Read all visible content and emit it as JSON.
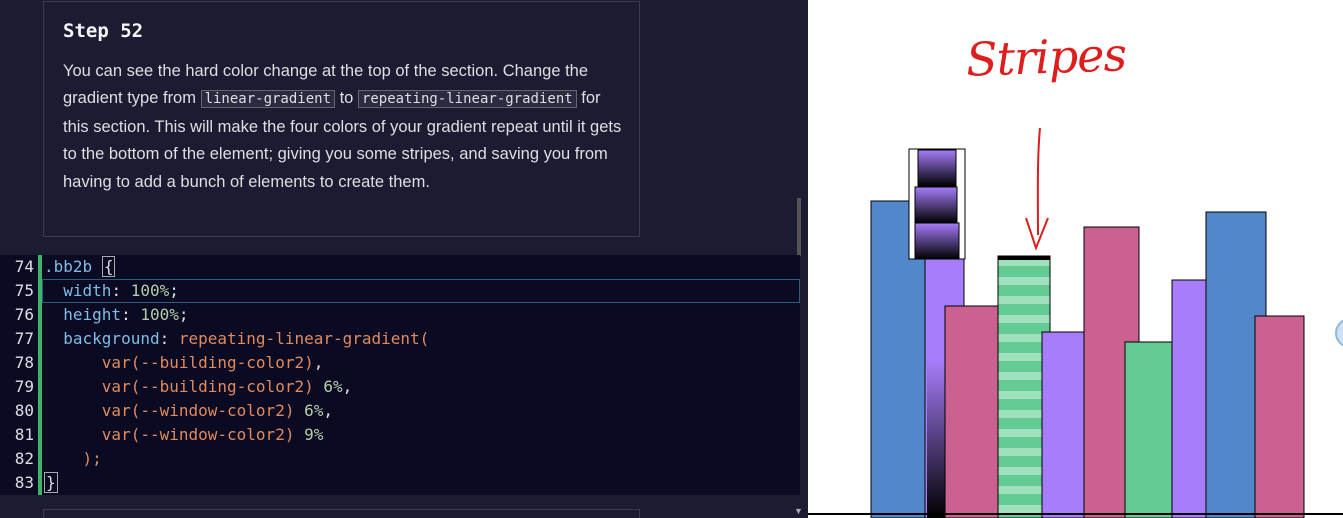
{
  "step": {
    "title": "Step 52"
  },
  "description": {
    "part1": "You can see the hard color change at the top of the section. Change the gradient type from ",
    "code1": "linear-gradient",
    "part2": " to ",
    "code2": "repeating-linear-gradient",
    "part3": " for this section. This will make the four colors of your gradient repeat until it gets to the bottom of the element; giving you some stripes, and saving you from having to add a bunch of elements to create them."
  },
  "editor": {
    "lines": [
      {
        "n": "74",
        "sel": ".bb2b",
        "brace": "{"
      },
      {
        "n": "75",
        "prop": "width",
        "value": "100%"
      },
      {
        "n": "76",
        "prop": "height",
        "value": "100%"
      },
      {
        "n": "77",
        "prop": "background",
        "fn": "repeating-linear-gradient("
      },
      {
        "n": "78",
        "fn": "var(--building-color2)",
        "tail": ","
      },
      {
        "n": "79",
        "fn": "var(--building-color2)",
        "num": "6%",
        "tail": ","
      },
      {
        "n": "80",
        "fn": "var(--window-color2)",
        "num": "6%",
        "tail": ","
      },
      {
        "n": "81",
        "fn": "var(--window-color2)",
        "num": "9%",
        "tail": ""
      },
      {
        "n": "82",
        "fn": ");"
      },
      {
        "n": "83",
        "brace": "}"
      }
    ]
  },
  "preview": {
    "annotation": "Stripes",
    "colors": {
      "blue": "#5287c9",
      "purple": "#a77dfb",
      "pink": "#ca6190",
      "green": "#64cb95",
      "annotation_red": "#e01d1d"
    }
  }
}
